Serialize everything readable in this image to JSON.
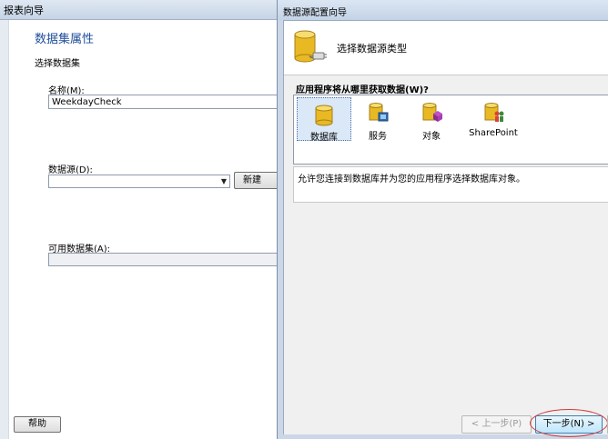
{
  "background_window": {
    "title": "报表向导",
    "page_heading": "数据集属性",
    "page_subtitle": "选择数据集",
    "name_label": "名称(M):",
    "name_value": "WeekdayCheck",
    "datasource_label": "数据源(D):",
    "datasource_value": "",
    "new_button_label": "新建(E)...",
    "available_datasets_label": "可用数据集(A):",
    "help_button_label": "帮助"
  },
  "dialog": {
    "title": "数据源配置向导",
    "header_title": "选择数据源类型",
    "question": "应用程序将从哪里获取数据(W)?",
    "source_types": [
      {
        "label": "数据库",
        "icon": "database-icon",
        "selected": true
      },
      {
        "label": "服务",
        "icon": "service-icon",
        "selected": false
      },
      {
        "label": "对象",
        "icon": "object-icon",
        "selected": false
      },
      {
        "label": "SharePoint",
        "icon": "sharepoint-icon",
        "selected": false
      }
    ],
    "description": "允许您连接到数据库并为您的应用程序选择数据库对象。",
    "prev_button_label": "< 上一步(P)",
    "next_button_label": "下一步(N) >"
  },
  "colors": {
    "heading_blue": "#1f4e9b",
    "db_gold": "#e8b923",
    "annotation_red": "#d23a3a"
  }
}
